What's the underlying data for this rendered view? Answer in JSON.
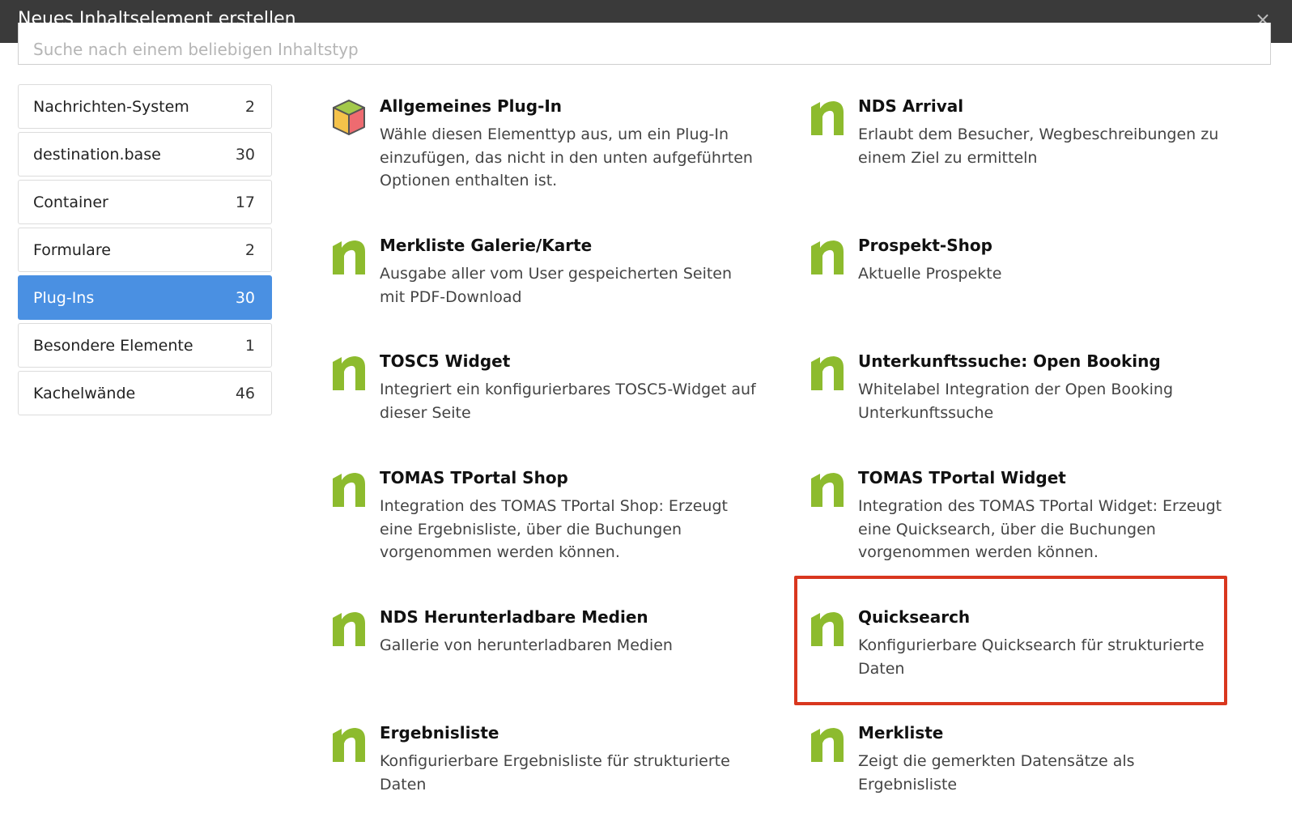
{
  "dialog": {
    "title": "Neues Inhaltselement erstellen",
    "close_symbol": "×",
    "search_placeholder": "Suche nach einem beliebigen Inhaltstyp"
  },
  "sidebar": {
    "items": [
      {
        "label": "Nachrichten-System",
        "count": "2"
      },
      {
        "label": "destination.base",
        "count": "30"
      },
      {
        "label": "Container",
        "count": "17"
      },
      {
        "label": "Formulare",
        "count": "2"
      },
      {
        "label": "Plug-Ins",
        "count": "30",
        "active": true
      },
      {
        "label": "Besondere Elemente",
        "count": "1"
      },
      {
        "label": "Kachelwände",
        "count": "46"
      }
    ]
  },
  "elements": [
    {
      "name": "Allgemeines Plug-In",
      "desc": "Wähle diesen Elementtyp aus, um ein Plug-In einzufügen, das nicht in den unten aufgeführten Optionen enthalten ist.",
      "icon": "cube-icon"
    },
    {
      "name": "NDS Arrival",
      "desc": "Erlaubt dem Besucher, Wegbeschreibungen zu einem Ziel zu ermitteln",
      "icon": "n-logo-icon"
    },
    {
      "name": "Merkliste Galerie/Karte",
      "desc": "Ausgabe aller vom User gespeicherten Seiten mit PDF-Download",
      "icon": "n-logo-icon"
    },
    {
      "name": "Prospekt-Shop",
      "desc": "Aktuelle Prospekte",
      "icon": "n-logo-icon"
    },
    {
      "name": "TOSC5 Widget",
      "desc": "Integriert ein konfigurierbares TOSC5-Widget auf dieser Seite",
      "icon": "n-logo-icon"
    },
    {
      "name": "Unterkunftssuche: Open Booking",
      "desc": "Whitelabel Integration der Open Booking Unterkunftssuche",
      "icon": "n-logo-icon"
    },
    {
      "name": "TOMAS TPortal Shop",
      "desc": "Integration des TOMAS TPortal Shop: Erzeugt eine Ergebnisliste, über die Buchungen vorgenommen werden können.",
      "icon": "n-logo-icon"
    },
    {
      "name": "TOMAS TPortal Widget",
      "desc": "Integration des TOMAS TPortal Widget: Erzeugt eine Quicksearch, über die Buchungen vorgenommen werden können.",
      "icon": "n-logo-icon"
    },
    {
      "name": "NDS Herunterladbare Medien",
      "desc": "Gallerie von herunterladbaren Medien",
      "icon": "n-logo-icon"
    },
    {
      "name": "Quicksearch",
      "desc": "Konfigurierbare Quicksearch für strukturierte Daten",
      "icon": "n-logo-icon"
    },
    {
      "name": "Ergebnisliste",
      "desc": "Konfigurierbare Ergebnisliste für strukturierte Daten",
      "icon": "n-logo-icon"
    },
    {
      "name": "Merkliste",
      "desc": "Zeigt die gemerkten Datensätze als Ergebnisliste",
      "icon": "n-logo-icon"
    }
  ],
  "colors": {
    "titlebar": "#3a3a3a",
    "active": "#4a90e2",
    "logo_green": "#8dbb2e",
    "highlight": "#d9371f"
  }
}
